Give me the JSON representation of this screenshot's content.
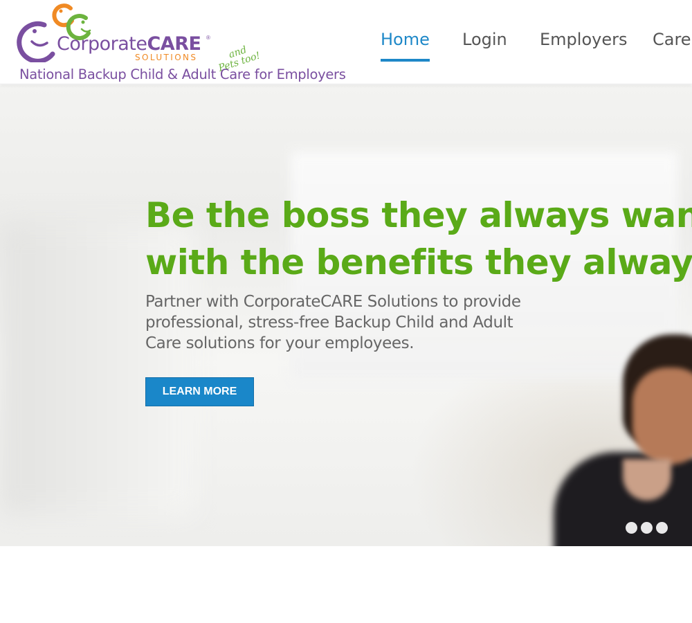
{
  "logo": {
    "word_left": "Corporate",
    "word_right": "CARE",
    "registered": "®",
    "solutions": "SOLUTIONS",
    "pets_and": "and",
    "pets_line": "Pets too!",
    "tagline": "National Backup Child & Adult Care for Employers",
    "colors": {
      "purple": "#7a4fa0",
      "orange": "#f08a24",
      "green": "#6cb33e"
    }
  },
  "nav": {
    "items": [
      {
        "label": "Home",
        "active": true
      },
      {
        "label": "Login",
        "active": false
      },
      {
        "label": "Employers",
        "active": false
      },
      {
        "label": "Care P",
        "active": false
      }
    ],
    "active_color": "#1e88c8"
  },
  "hero": {
    "headline_line1": "Be the boss they always wanted.",
    "headline_line2": "with the benefits they always ne",
    "subtext": "Partner with CorporateCARE Solutions to provide professional, stress-free Backup Child and Adult Care solutions for your employees.",
    "cta_label": "LEARN MORE",
    "headline_color": "#5aaa18",
    "cta_color": "#1a87c9",
    "slide_count": 3
  }
}
